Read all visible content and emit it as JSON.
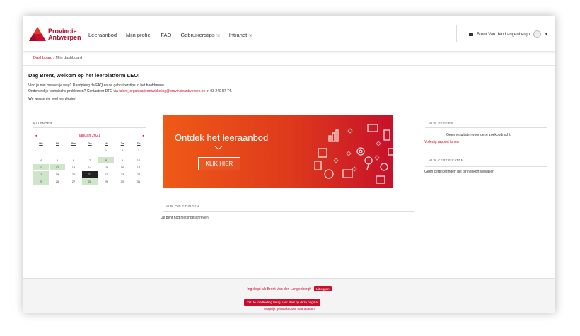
{
  "brand": {
    "line1": "Provincie",
    "line2": "Antwerpen",
    "accent": "#c8102e"
  },
  "nav": {
    "items": [
      {
        "label": "Leeraanbod"
      },
      {
        "label": "Mijn profiel"
      },
      {
        "label": "FAQ"
      },
      {
        "label": "Gebruikerstips",
        "arrow": "⇲"
      },
      {
        "label": "Intranet",
        "arrow": "⇲"
      }
    ]
  },
  "user": {
    "name": "Brent Van den Langenbergh"
  },
  "breadcrumb": {
    "dashboard": "Dashboard",
    "sep": "/",
    "current": "Mijn dashboard"
  },
  "welcome": {
    "title": "Dag Brent, welkom op het leerplatform LEO!",
    "line1": "Vind je niet meteen je weg? Raadpleeg de FAQ en de gebruikerstips in het hoofdmenu.",
    "line2_prefix": "Ondervind je technische problemen? Contacteer DTO via ",
    "line2_email": "talent_organisatieontwikkeling@provincieantwerpen.be",
    "line2_suffix": " of 03 240 57 74.",
    "line3": "We wensen je veel leerplezier!"
  },
  "calendar": {
    "title": "KALENDER",
    "month": "januari 2021",
    "prev": "◄",
    "next": "►",
    "days": [
      "Ma",
      "Di",
      "Wo",
      "Do",
      "Vr",
      "Za",
      "Zo"
    ],
    "weeks": [
      [
        "",
        "",
        "",
        "",
        "1",
        "2",
        "3"
      ],
      [
        "4",
        "5",
        "6",
        "7",
        "8",
        "9",
        "10"
      ],
      [
        "11",
        "12",
        "13",
        "14",
        "15",
        "16",
        "17"
      ],
      [
        "18",
        "19",
        "20",
        "21",
        "22",
        "23",
        "24"
      ],
      [
        "25",
        "26",
        "27",
        "28",
        "29",
        "30",
        "31"
      ]
    ]
  },
  "banner": {
    "headline": "Ontdek het leeraanbod",
    "button": "KLIK HIER"
  },
  "opleidingen": {
    "title": "MIJN OPLEIDINGEN",
    "empty": "Je bent nog niet ingeschreven."
  },
  "sessies": {
    "title": "MIJN SESSIES",
    "empty": "Geen resultaten voor deze zoekopdracht.",
    "link": "Volledig rapport tonen"
  },
  "certificaten": {
    "title": "MIJN CERTIFICATEN",
    "empty": "Geen certificeringen die binnenkort vervallen"
  },
  "footer": {
    "logged_in": "Ingelogd als Brent Van den Langenbergh",
    "logout": "Uitloggen",
    "tour": "Zet de rondleiding terug naar start op deze pagina",
    "powered": "Mogelijk gemaakt door Totara Learn"
  }
}
